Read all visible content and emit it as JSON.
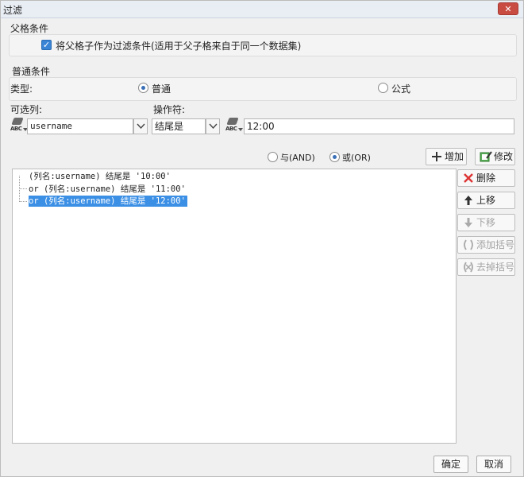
{
  "window": {
    "title": "过滤"
  },
  "parent_section": {
    "title": "父格条件",
    "checkbox_label": "将父格子作为过滤条件(适用于父子格来自于同一个数据集)",
    "checked": true
  },
  "general_section": {
    "title": "普通条件",
    "type_label": "类型:",
    "type_options": [
      {
        "label": "普通",
        "selected": true
      },
      {
        "label": "公式",
        "selected": false
      }
    ],
    "column_label": "可选列:",
    "column_value": "username",
    "operator_label": "操作符:",
    "operator_value": "结尾是",
    "value": "12:00",
    "logic_options": [
      {
        "label": "与(AND)",
        "selected": false
      },
      {
        "label": "或(OR)",
        "selected": true
      }
    ]
  },
  "toolbar": {
    "add": "增加",
    "modify": "修改",
    "delete": "删除",
    "move_up": "上移",
    "move_down": "下移",
    "add_bracket": "添加括号",
    "remove_bracket": "去掉括号"
  },
  "conditions": [
    {
      "text": "(列名:username) 结尾是 '10:00'",
      "selected": false
    },
    {
      "text": "or  (列名:username) 结尾是 '11:00'",
      "selected": false
    },
    {
      "text": "or  (列名:username) 结尾是 '12:00'",
      "selected": true
    }
  ],
  "footer": {
    "ok": "确定",
    "cancel": "取消"
  },
  "colors": {
    "accent": "#3b8fe5",
    "close": "#c94c43",
    "checkbox": "#3a84d6"
  }
}
